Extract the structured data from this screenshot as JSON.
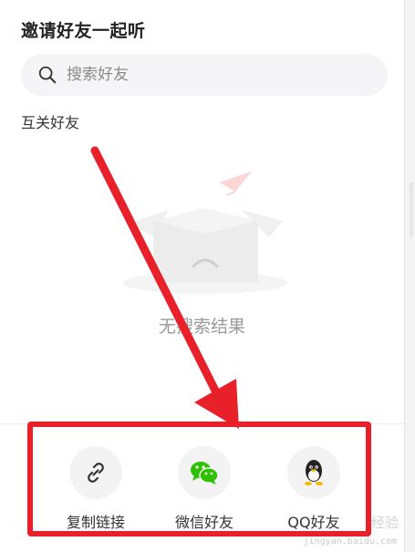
{
  "dialog": {
    "title": "邀请好友一起听",
    "search": {
      "placeholder": "搜索好友",
      "value": ""
    },
    "section_label": "互关好友",
    "empty_text": "无搜索结果"
  },
  "share": {
    "items": [
      {
        "label": "复制链接",
        "icon": "link-icon"
      },
      {
        "label": "微信好友",
        "icon": "wechat-icon"
      },
      {
        "label": "QQ好友",
        "icon": "qq-penguin-icon"
      }
    ]
  },
  "annotation": {
    "color": "#e8202a"
  },
  "watermark": {
    "text": "经验",
    "sub": "jingyan.baidu.com"
  }
}
